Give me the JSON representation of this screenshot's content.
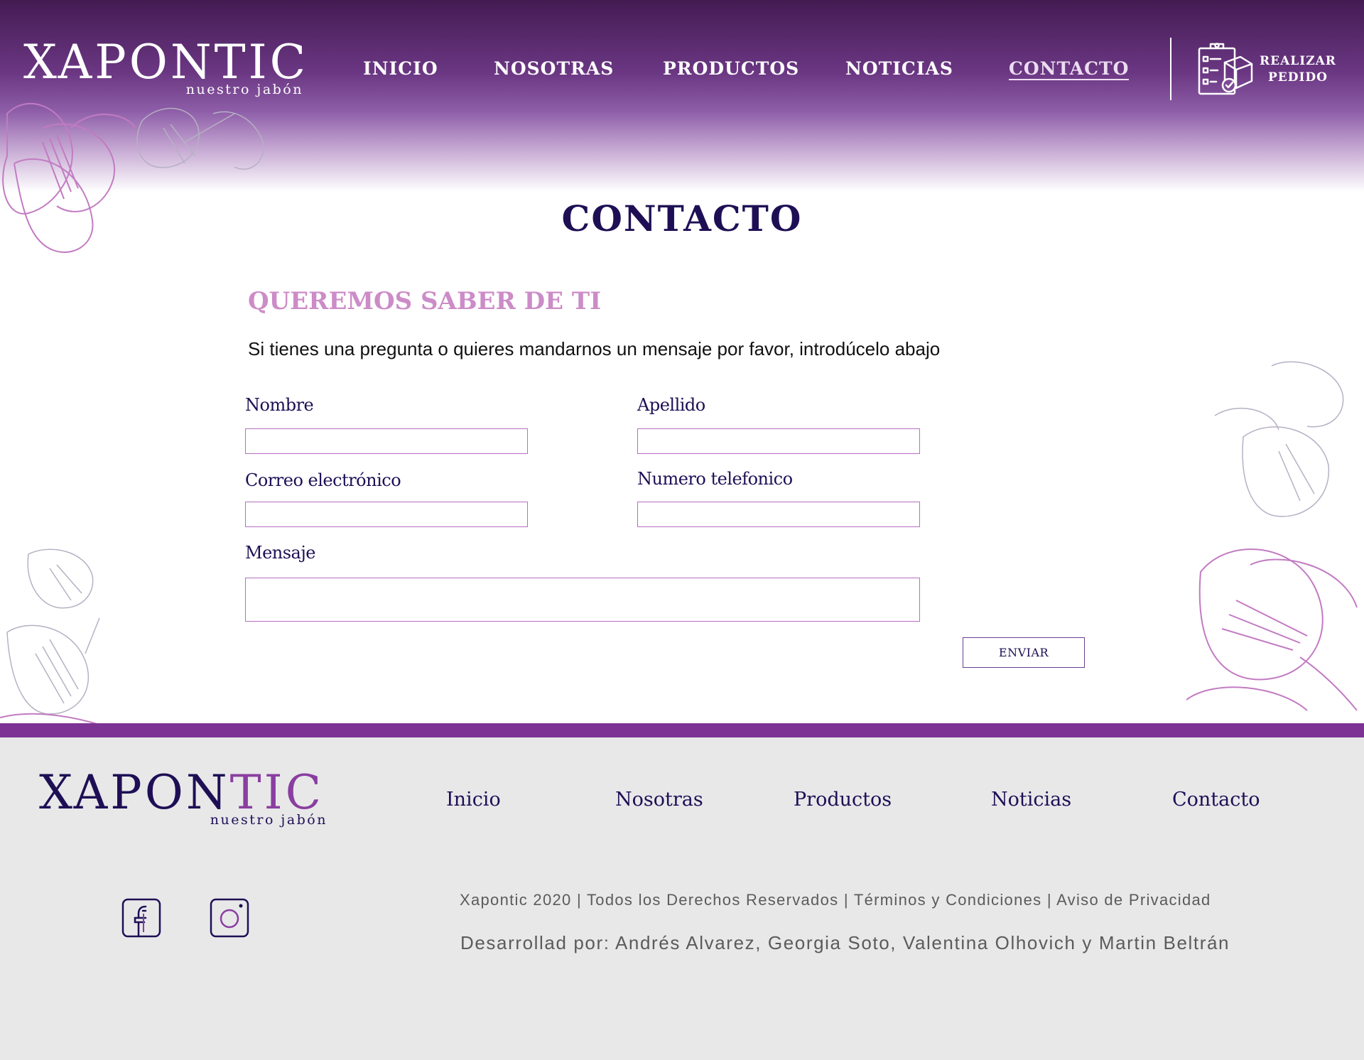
{
  "header": {
    "logo": {
      "main": "XAPONTIC",
      "sub": "nuestro jabón"
    },
    "nav": [
      {
        "label": "INICIO"
      },
      {
        "label": "NOSOTRAS"
      },
      {
        "label": "PRODUCTOS"
      },
      {
        "label": "NOTICIAS"
      },
      {
        "label": "CONTACTO",
        "active": true
      }
    ],
    "order_button": {
      "line1": "REALIZAR",
      "line2": "PEDIDO",
      "icon": "order-clipboard-icon"
    }
  },
  "main": {
    "title": "CONTACTO",
    "section_title": "QUEREMOS SABER DE TI",
    "intro": "Si tienes una pregunta o quieres mandarnos un mensaje por favor, introdúcelo abajo",
    "form": {
      "nombre_label": "Nombre",
      "apellido_label": "Apellido",
      "correo_label": "Correo electrónico",
      "telefono_label": "Numero telefonico",
      "mensaje_label": "Mensaje",
      "nombre_value": "",
      "apellido_value": "",
      "correo_value": "",
      "telefono_value": "",
      "mensaje_value": "",
      "submit_label": "ENVIAR"
    }
  },
  "footer": {
    "logo": {
      "main_a": "XAPON",
      "main_b": "TIC",
      "sub": "nuestro jabón"
    },
    "links": [
      {
        "label": "Inicio"
      },
      {
        "label": "Nosotras"
      },
      {
        "label": "Productos"
      },
      {
        "label": "Noticias"
      },
      {
        "label": "Contacto"
      }
    ],
    "social": [
      {
        "icon": "facebook-icon"
      },
      {
        "icon": "instagram-icon"
      }
    ],
    "legal": "Xapontic 2020 | Todos los Derechos Reservados | Términos y Condiciones | Aviso de Privacidad",
    "credits": "Desarrollad por: Andrés Alvarez, Georgia Soto, Valentina Olhovich y Martin Beltrán"
  },
  "colors": {
    "brand_purple": "#7d3393",
    "navy": "#1e0f55",
    "pink": "#cc8cc7",
    "footer_bg": "#e8e8e9",
    "field_border": "#b56fc0"
  }
}
